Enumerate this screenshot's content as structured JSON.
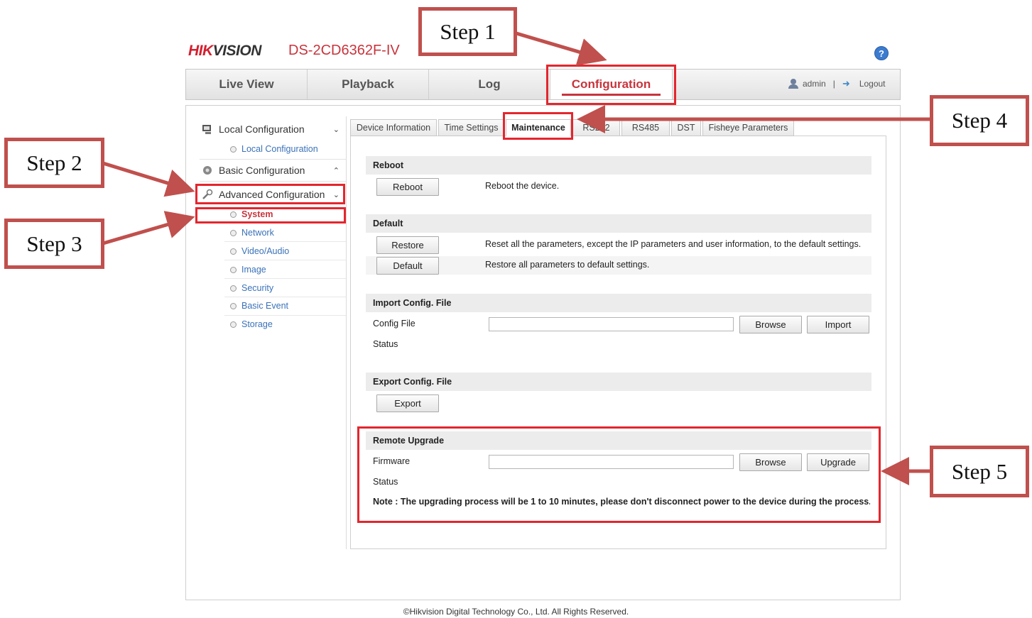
{
  "header": {
    "logo_hik": "HIK",
    "logo_vision": "VISION",
    "model": "DS-2CD6362F-IV",
    "help_icon": "?"
  },
  "nav": {
    "tabs": [
      "Live View",
      "Playback",
      "Log",
      "Configuration"
    ],
    "active": "Configuration",
    "user": "admin",
    "separator": "|",
    "logout": "Logout"
  },
  "sidebar": {
    "local_config": "Local Configuration",
    "local_config_sub": "Local Configuration",
    "basic_config": "Basic Configuration",
    "advanced_config": "Advanced Configuration",
    "items": [
      "System",
      "Network",
      "Video/Audio",
      "Image",
      "Security",
      "Basic Event",
      "Storage"
    ],
    "active_item": "System"
  },
  "tabs": {
    "items": [
      "Device Information",
      "Time Settings",
      "Maintenance",
      "RS232",
      "RS485",
      "DST",
      "Fisheye Parameters"
    ],
    "active": "Maintenance"
  },
  "reboot": {
    "title": "Reboot",
    "button": "Reboot",
    "desc": "Reboot the device."
  },
  "default_section": {
    "title": "Default",
    "restore_button": "Restore",
    "restore_desc": "Reset all the parameters, except the IP parameters and user information, to the default settings.",
    "default_button": "Default",
    "default_desc": "Restore all parameters to default settings."
  },
  "import_config": {
    "title": "Import Config. File",
    "file_label": "Config File",
    "file_value": "",
    "browse": "Browse",
    "import": "Import",
    "status_label": "Status"
  },
  "export_config": {
    "title": "Export Config. File",
    "export": "Export"
  },
  "remote_upgrade": {
    "title": "Remote Upgrade",
    "firmware_label": "Firmware",
    "firmware_value": "",
    "browse": "Browse",
    "upgrade": "Upgrade",
    "status_label": "Status",
    "note": "Note :  The upgrading process will be 1 to 10 minutes, please don't disconnect power to the device during the process...."
  },
  "callouts": [
    "Step 1",
    "Step 2",
    "Step 3",
    "Step 4",
    "Step 5"
  ],
  "footer": "©Hikvision Digital Technology Co., Ltd. All Rights Reserved.",
  "colors": {
    "brand_red": "#c8343c",
    "highlight_red": "#e4262d",
    "callout_border": "#c0504d",
    "link_blue": "#3a72b8"
  }
}
